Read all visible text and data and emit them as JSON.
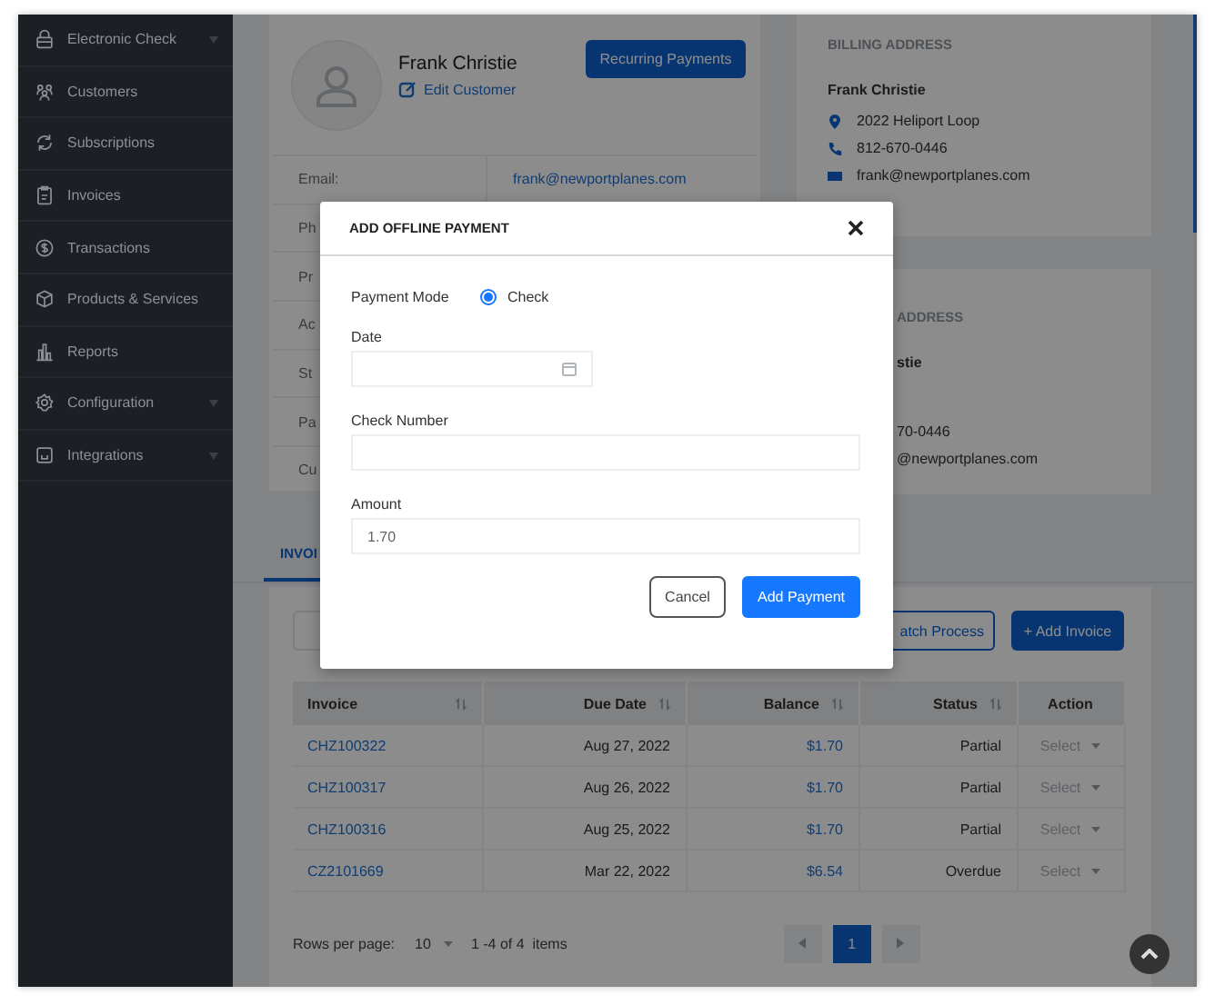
{
  "sidebar": {
    "items": [
      {
        "label": "Electronic Check",
        "expandable": true
      },
      {
        "label": "Customers",
        "expandable": false
      },
      {
        "label": "Subscriptions",
        "expandable": false
      },
      {
        "label": "Invoices",
        "expandable": false
      },
      {
        "label": "Transactions",
        "expandable": false
      },
      {
        "label": "Products & Services",
        "expandable": false
      },
      {
        "label": "Reports",
        "expandable": false
      },
      {
        "label": "Configuration",
        "expandable": true
      },
      {
        "label": "Integrations",
        "expandable": true
      }
    ]
  },
  "customer": {
    "name": "Frank Christie",
    "edit_link": "Edit Customer",
    "recurring_button": "Recurring Payments",
    "details": [
      {
        "label": "Email:",
        "value": "frank@newportplanes.com"
      },
      {
        "label": "Ph"
      },
      {
        "label": "Pr"
      },
      {
        "label": "Ac"
      },
      {
        "label": "St"
      },
      {
        "label": "Pa"
      },
      {
        "label": "Cu"
      }
    ]
  },
  "billing_address": {
    "title": "BILLING ADDRESS",
    "name": "Frank Christie",
    "lines": [
      {
        "kind": "address",
        "text": "2022 Heliport Loop"
      },
      {
        "kind": "phone",
        "text": "812-670-0446"
      },
      {
        "kind": "email",
        "text": "frank@newportplanes.com"
      }
    ]
  },
  "shipping_address": {
    "title": "ADDRESS",
    "name": "stie",
    "lines": [
      "70-0446",
      "@newportplanes.com"
    ]
  },
  "tabs": [
    {
      "label": "INVOI",
      "selected": true
    }
  ],
  "invoices": {
    "batch_button": "atch Process",
    "add_button": "+ Add Invoice",
    "columns": [
      {
        "label": "Invoice",
        "sortable": true
      },
      {
        "label": "Due Date",
        "sortable": true
      },
      {
        "label": "Balance",
        "sortable": true
      },
      {
        "label": "Status",
        "sortable": true
      },
      {
        "label": "Action",
        "sortable": false
      }
    ],
    "rows": [
      {
        "invoice": "CHZ100322",
        "due_date": "Aug 27, 2022",
        "balance": "$1.70",
        "status": "Partial",
        "action": "Select"
      },
      {
        "invoice": "CHZ100317",
        "due_date": "Aug 26, 2022",
        "balance": "$1.70",
        "status": "Partial",
        "action": "Select"
      },
      {
        "invoice": "CHZ100316",
        "due_date": "Aug 25, 2022",
        "balance": "$1.70",
        "status": "Partial",
        "action": "Select"
      },
      {
        "invoice": "CZ2101669",
        "due_date": "Mar 22, 2022",
        "balance": "$6.54",
        "status": "Overdue",
        "action": "Select"
      }
    ]
  },
  "pagination": {
    "rows_per_page_label": "Rows per page:",
    "rows_per_page": "10",
    "range": "1 -4 of 4  items",
    "pages": [
      {
        "label": "1",
        "selected": true
      }
    ]
  },
  "modal": {
    "title": "ADD OFFLINE PAYMENT",
    "payment_mode_label": "Payment Mode",
    "payment_options": [
      {
        "label": "Check",
        "selected": true
      }
    ],
    "fields": [
      {
        "kind": "date",
        "label": "Date"
      },
      {
        "kind": "text",
        "label": "Check Number"
      },
      {
        "kind": "text",
        "label": "Amount",
        "value": "1.70"
      }
    ],
    "cancel_button": "Cancel",
    "submit_button": "Add Payment"
  }
}
